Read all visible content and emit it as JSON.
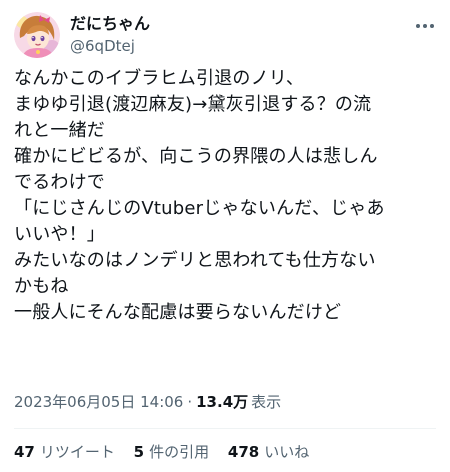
{
  "author": {
    "display_name": "だにちゃん",
    "handle": "@6qDtej",
    "avatar_icon": "anime-character-avatar",
    "more_icon": "more-options-icon"
  },
  "body": {
    "lines": [
      "なんかこのイブラヒム引退のノリ、",
      "まゆゆ引退(渡辺麻友)→黛灰引退する？の流",
      "れと一緒だ",
      "確かにビビるが、向こうの界隈の人は悲しん",
      "でるわけで",
      "「にじさんじのVtuberじゃないんだ、じゃあ",
      "いいや！」",
      "みたいなのはノンデリと思われても仕方ない",
      "かもね",
      "一般人にそんな配慮は要らないんだけど"
    ]
  },
  "meta": {
    "timestamp": "2023年06月05日 14:06",
    "separator": "·",
    "views_count": "13.4万",
    "views_label": "表示"
  },
  "stats": {
    "retweets_count": "47",
    "retweets_label": "リツイート",
    "quotes_count": "5",
    "quotes_label": "件の引用",
    "likes_count": "478",
    "likes_label": "いいね"
  },
  "colors": {
    "text_primary": "#0f1419",
    "text_secondary": "#536471",
    "divider": "#eff3f4"
  }
}
